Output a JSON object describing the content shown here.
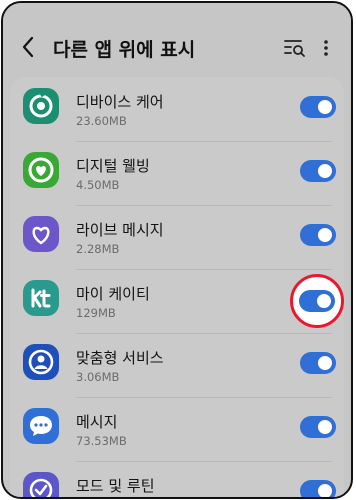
{
  "header": {
    "title": "다른 앱 위에 표시",
    "back_icon": "back-arrow-icon",
    "search_icon": "search-list-icon",
    "more_icon": "more-vertical-icon"
  },
  "apps": [
    {
      "name": "디바이스 케어",
      "size": "23.60MB",
      "icon": "device-care-icon",
      "icon_color": "#1c8f72",
      "enabled": true
    },
    {
      "name": "디지털 웰빙",
      "size": "4.50MB",
      "icon": "digital-wellbeing-icon",
      "icon_color": "#3aa835",
      "enabled": true
    },
    {
      "name": "라이브 메시지",
      "size": "2.28MB",
      "icon": "live-message-icon",
      "icon_color": "#6b57c9",
      "enabled": true
    },
    {
      "name": "마이 케이티",
      "size": "129MB",
      "icon": "kt-icon",
      "icon_color": "#2a9a8f",
      "enabled": true
    },
    {
      "name": "맞춤형 서비스",
      "size": "3.06MB",
      "icon": "customization-service-icon",
      "icon_color": "#1f4fb8",
      "enabled": true
    },
    {
      "name": "메시지",
      "size": "73.53MB",
      "icon": "messages-icon",
      "icon_color": "#2f6fd6",
      "enabled": true
    },
    {
      "name": "모드 및 루틴",
      "size": "",
      "icon": "modes-routines-icon",
      "icon_color": "#5b57c9",
      "enabled": true
    }
  ],
  "colors": {
    "toggle_on": "#2f6fd6",
    "highlight": "#e6192e"
  }
}
